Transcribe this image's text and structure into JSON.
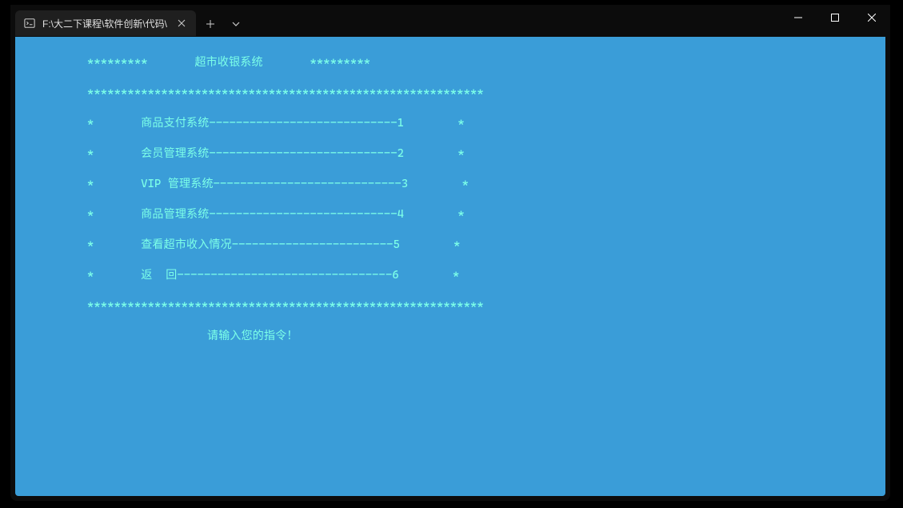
{
  "tab": {
    "title": "F:\\大二下课程\\软件创新\\代码\\"
  },
  "terminal": {
    "header_stars_left": "*********",
    "header_title": "超市收银系统",
    "header_stars_right": "*********",
    "divider": "***********************************************************",
    "menu_items": [
      {
        "label": "商品支付系统",
        "dashes": "----------------------------",
        "num": "1"
      },
      {
        "label": "会员管理系统",
        "dashes": "----------------------------",
        "num": "2"
      },
      {
        "label": "VIP 管理系统",
        "dashes": "----------------------------",
        "num": "3"
      },
      {
        "label": "商品管理系统",
        "dashes": "----------------------------",
        "num": "4"
      },
      {
        "label": "查看超市收入情况",
        "dashes": "------------------------",
        "num": "5"
      },
      {
        "label": "返  回",
        "dashes": "--------------------------------",
        "num": "6"
      }
    ],
    "prompt": "请输入您的指令！"
  }
}
